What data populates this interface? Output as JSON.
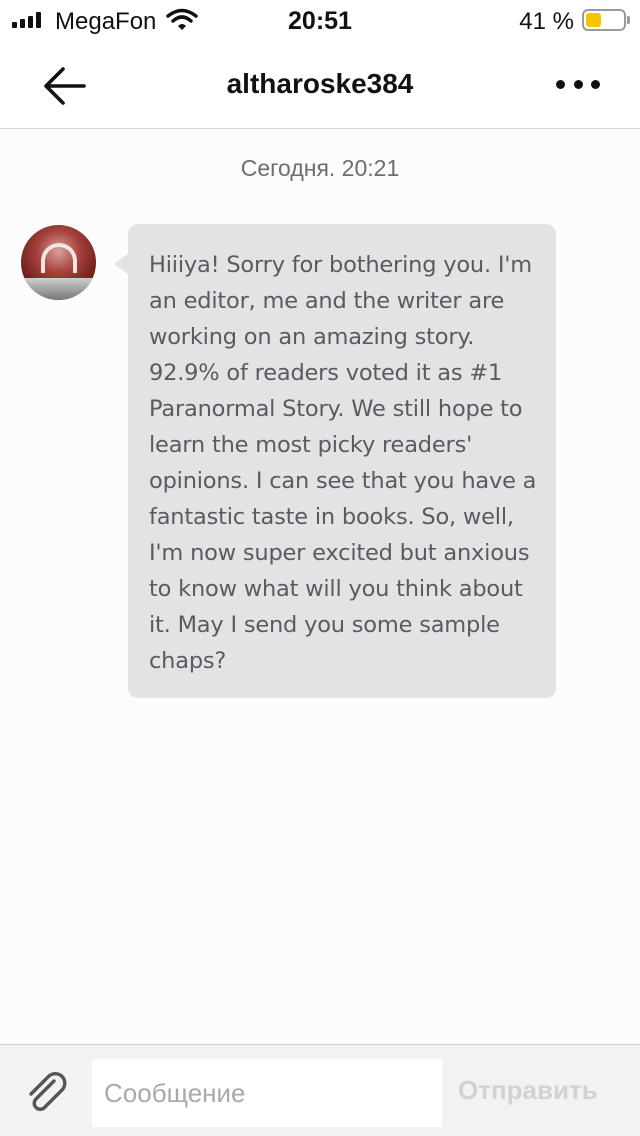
{
  "status_bar": {
    "carrier": "MegaFon",
    "time": "20:51",
    "battery_percent": "41 %",
    "battery_level": 0.41,
    "icons": [
      "signal-icon",
      "wifi-icon",
      "battery-icon"
    ]
  },
  "header": {
    "title": "altharoske384",
    "icons": [
      "back-arrow-icon",
      "more-icon"
    ]
  },
  "chat": {
    "date_separator": "Сегодня. 20:21",
    "messages": [
      {
        "text": "Hiiiya! Sorry for bothering you. I'm an editor, me and the writer are working on an amazing story. 92.9% of readers voted it as #1 Paranormal Story. We still hope to learn the most picky readers' opinions. I can see that you have a fantastic taste in books. So, well, I'm now super excited but anxious to know what will you think about it. May I send you some sample chaps?"
      }
    ]
  },
  "composer": {
    "placeholder": "Сообщение",
    "value": "",
    "send_label": "Отправить",
    "icons": [
      "paperclip-icon"
    ]
  },
  "colors": {
    "bubble": "#e3e2e5",
    "bubble_text": "#5d5a5f",
    "battery_fill": "#f6c500",
    "send_disabled": "#d2d2d4"
  }
}
